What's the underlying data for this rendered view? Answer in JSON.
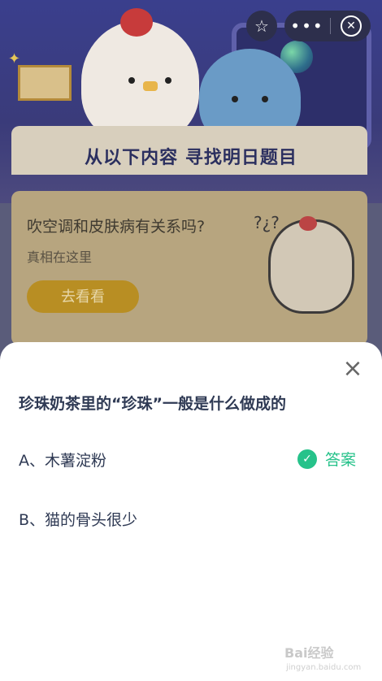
{
  "top_bar": {
    "favorite_icon": "star-icon",
    "more_icon": "more-dots-icon",
    "close_icon": "close-circle-icon"
  },
  "banner": {
    "title": "从以下内容 寻找明日题目"
  },
  "card": {
    "question": "吹空调和皮肤病有关系吗?",
    "subtitle": "真相在这里",
    "button_label": "去看看"
  },
  "quiz": {
    "question": "珍珠奶茶里的“珍珠”一般是什么做成的",
    "options": [
      {
        "label": "A、木薯淀粉",
        "is_answer": true
      },
      {
        "label": "B、猫的骨头很少",
        "is_answer": false
      }
    ],
    "answer_label": "答案",
    "answer_color": "#26c28a"
  },
  "watermark": {
    "text": "Bai经验",
    "url_text": "jingyan.baidu.com"
  }
}
